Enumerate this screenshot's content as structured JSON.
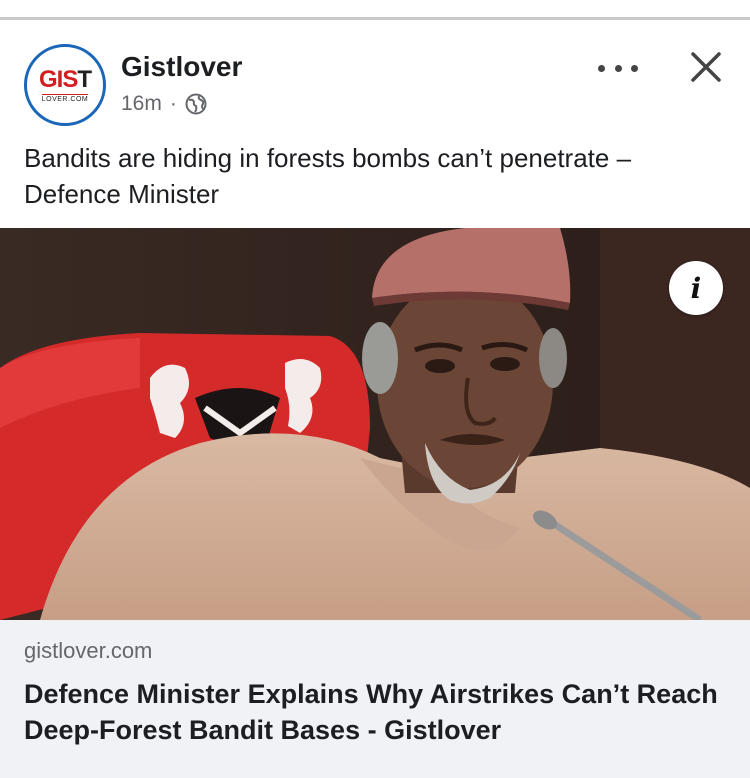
{
  "post": {
    "author": "Gistlover",
    "timestamp": "16m",
    "separator": "·",
    "audience_icon": "globe-icon",
    "caption": "Bandits are hiding in forests bombs can’t penetrate – Defence Minister"
  },
  "avatar": {
    "logo_main_a": "GIS",
    "logo_main_b": "T",
    "logo_sub": "LOVER.COM"
  },
  "link_preview": {
    "domain": "gistlover.com",
    "headline": "Defence Minister Explains Why Airstrikes Can’t Reach Deep-Forest Bandit Bases - Gistlover"
  },
  "icons": {
    "more": "more-options-icon",
    "close": "close-icon",
    "info": "info-icon"
  },
  "info_glyph": "i",
  "colors": {
    "brand_ring": "#1a66b8",
    "brand_red": "#d11f1f",
    "card_bg": "#f0f2f5",
    "secondary_text": "#65676b"
  }
}
